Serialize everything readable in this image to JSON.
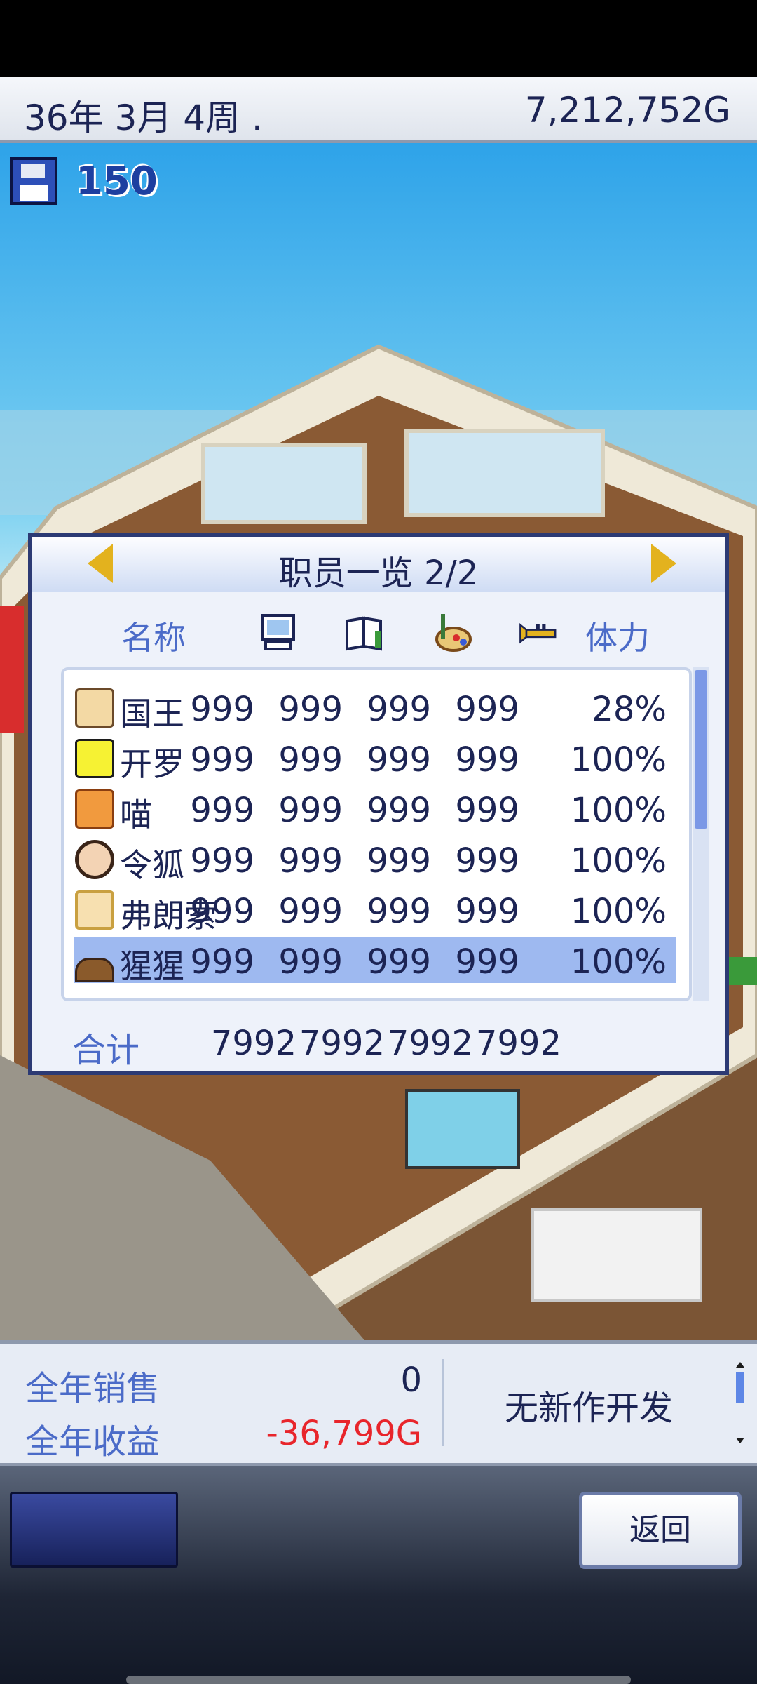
{
  "topbar": {
    "date": "36年 3月 4周 .",
    "money": "7,212,752G"
  },
  "save": {
    "count": "150",
    "icon": "floppy-disk-icon"
  },
  "panel": {
    "title": "职员一览 2/2",
    "columns": {
      "name": "名称",
      "stamina": "体力",
      "icons": [
        "computer-icon",
        "notebook-icon",
        "paint-palette-icon",
        "trumpet-icon"
      ]
    },
    "rows": [
      {
        "name": "国王",
        "v1": "999",
        "v2": "999",
        "v3": "999",
        "v4": "999",
        "stamina": "28%",
        "avatar_color": "#f3d9a4"
      },
      {
        "name": "开罗",
        "v1": "999",
        "v2": "999",
        "v3": "999",
        "v4": "999",
        "stamina": "100%",
        "avatar_color": "#f6f233"
      },
      {
        "name": "喵",
        "v1": "999",
        "v2": "999",
        "v3": "999",
        "v4": "999",
        "stamina": "100%",
        "avatar_color": "#f19a3e"
      },
      {
        "name": "令狐",
        "v1": "999",
        "v2": "999",
        "v3": "999",
        "v4": "999",
        "stamina": "100%",
        "avatar_color": "#5b3a28"
      },
      {
        "name": "弗朗索",
        "v1": "999",
        "v2": "999",
        "v3": "999",
        "v4": "999",
        "stamina": "100%",
        "avatar_color": "#e9c776"
      },
      {
        "name": "猩猩",
        "v1": "999",
        "v2": "999",
        "v3": "999",
        "v4": "999",
        "stamina": "100%",
        "avatar_color": "#8a5a2b"
      }
    ],
    "total": {
      "label": "合计",
      "v1": "7992",
      "v2": "7992",
      "v3": "7992",
      "v4": "7992"
    }
  },
  "sales": {
    "annual_sales_label": "全年销售",
    "annual_sales_value": "0",
    "annual_profit_label": "全年收益",
    "annual_profit_value": "-36,799G",
    "message": "无新作开发"
  },
  "buttons": {
    "back": "返回"
  },
  "colors": {
    "accent": "#4b6bc8",
    "negative": "#e8252b",
    "selected_row": "#9eb9f0",
    "arrow": "#e3b21e"
  }
}
